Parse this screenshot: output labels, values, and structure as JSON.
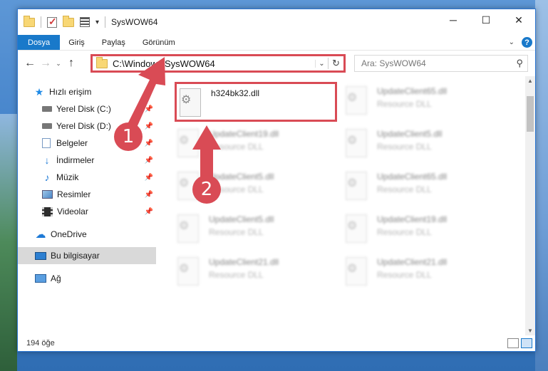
{
  "window": {
    "title": "SysWOW64"
  },
  "titlebar": {
    "controls": {
      "minimize": "─",
      "maximize": "☐",
      "close": "✕"
    }
  },
  "menu": {
    "items": [
      "Dosya",
      "Giriş",
      "Paylaş",
      "Görünüm"
    ],
    "active": "Dosya",
    "help": "?"
  },
  "nav": {
    "back": "←",
    "forward": "→",
    "recent": "⌄",
    "up": "↑"
  },
  "address": {
    "path": "C:\\Windows\\SysWOW64"
  },
  "search": {
    "placeholder": "Ara: SysWOW64"
  },
  "sidebar": {
    "items": [
      {
        "label": "Hızlı erişim",
        "icon": "star-icon",
        "pinned": false
      },
      {
        "label": "Yerel Disk (C:)",
        "icon": "drive-icon",
        "pinned": true
      },
      {
        "label": "Yerel Disk (D:)",
        "icon": "drive-icon",
        "pinned": true
      },
      {
        "label": "Belgeler",
        "icon": "document-icon",
        "pinned": true
      },
      {
        "label": "İndirmeler",
        "icon": "download-icon",
        "pinned": true
      },
      {
        "label": "Müzik",
        "icon": "music-icon",
        "pinned": true
      },
      {
        "label": "Resimler",
        "icon": "pictures-icon",
        "pinned": true
      },
      {
        "label": "Videolar",
        "icon": "video-icon",
        "pinned": true
      },
      {
        "label": "OneDrive",
        "icon": "cloud-icon",
        "pinned": false
      },
      {
        "label": "Bu bilgisayar",
        "icon": "computer-icon",
        "pinned": false,
        "selected": true
      },
      {
        "label": "Ağ",
        "icon": "network-icon",
        "pinned": false
      }
    ]
  },
  "files": [
    {
      "name": "h324bk32.dll",
      "type": "",
      "highlight": true,
      "blurred": false
    },
    {
      "name": "UpdateClient65.dll",
      "type": "Resource DLL",
      "blurred": true
    },
    {
      "name": "UpdateClient19.dll",
      "type": "Resource DLL",
      "blurred": true
    },
    {
      "name": "UpdateClient5.dll",
      "type": "Resource DLL",
      "blurred": true
    },
    {
      "name": "UpdateClient5.dll",
      "type": "Resource DLL",
      "blurred": true
    },
    {
      "name": "UpdateClient65.dll",
      "type": "Resource DLL",
      "blurred": true
    },
    {
      "name": "UpdateClient5.dll",
      "type": "Resource DLL",
      "blurred": true
    },
    {
      "name": "UpdateClient19.dll",
      "type": "Resource DLL",
      "blurred": true
    },
    {
      "name": "UpdateClient21.dll",
      "type": "Resource DLL",
      "blurred": true
    },
    {
      "name": "UpdateClient21.dll",
      "type": "Resource DLL",
      "blurred": true
    }
  ],
  "status": {
    "count": "194 öğe"
  },
  "annotations": [
    {
      "number": "1"
    },
    {
      "number": "2"
    }
  ],
  "colors": {
    "accent": "#1979ca",
    "annotation": "#d94b55"
  }
}
